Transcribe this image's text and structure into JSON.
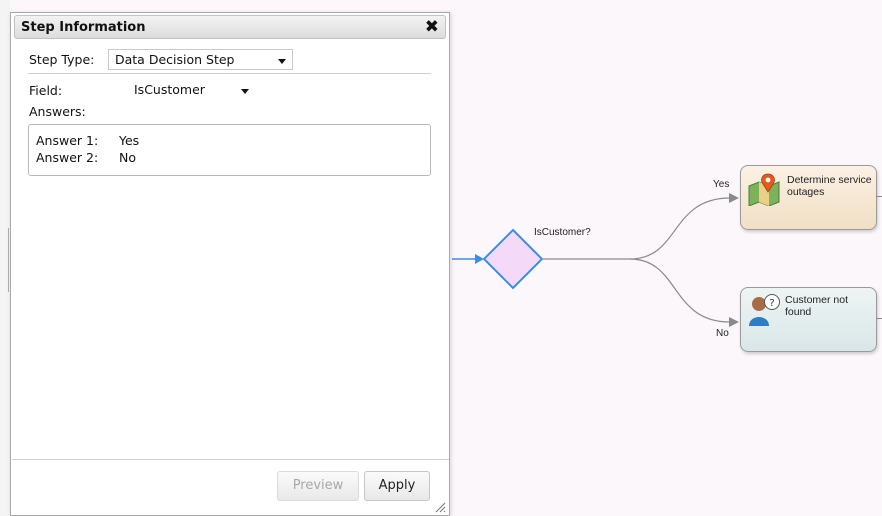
{
  "dialog": {
    "title": "Step Information",
    "close_symbol": "✖",
    "step_type_label": "Step Type:",
    "step_type_value": "Data Decision Step",
    "field_label": "Field:",
    "field_value": "IsCustomer",
    "answers_label": "Answers:",
    "answers": [
      {
        "key": "Answer 1:",
        "value": "Yes"
      },
      {
        "key": "Answer 2:",
        "value": "No"
      }
    ],
    "preview_label": "Preview",
    "apply_label": "Apply"
  },
  "flow": {
    "decision_label": "IsCustomer?",
    "edge_yes_label": "Yes",
    "edge_no_label": "No",
    "node_outages_label": "Determine service outages",
    "node_notfound_label": "Customer not found"
  },
  "colors": {
    "canvas_bg": "#fbf7fb",
    "decision_fill": "#f4d9f8",
    "decision_stroke": "#3a8ee6",
    "connector": "#8a8a8a",
    "incoming_arrow": "#3a8ee6"
  }
}
